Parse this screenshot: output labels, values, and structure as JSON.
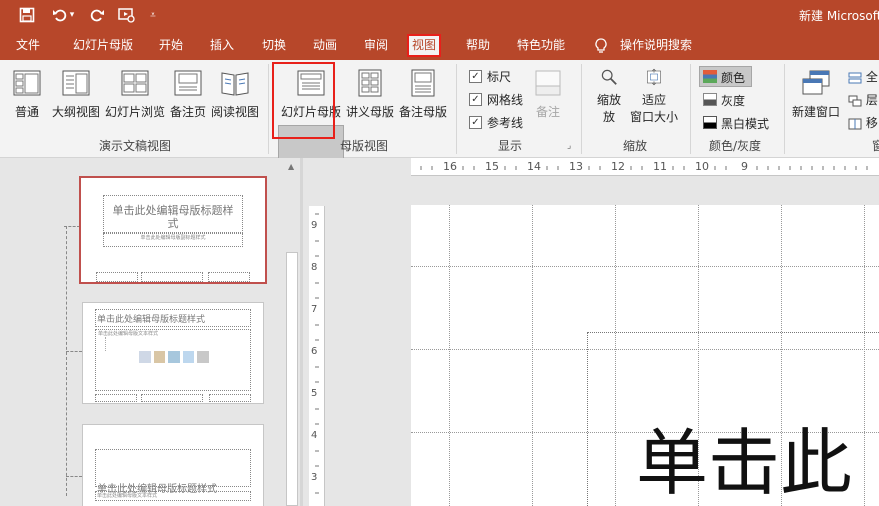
{
  "app": {
    "title": "新建 Microsoft"
  },
  "tabs": [
    "文件",
    "幻灯片母版",
    "开始",
    "插入",
    "切换",
    "动画",
    "审阅",
    "视图",
    "帮助",
    "特色功能"
  ],
  "active_tab": "视图",
  "tell_me": "操作说明搜索",
  "ribbon": {
    "presentation_views": {
      "label": "演示文稿视图",
      "buttons": [
        "普通",
        "大纲视图",
        "幻灯片浏览",
        "备注页",
        "阅读视图"
      ]
    },
    "master_views": {
      "label": "母版视图",
      "buttons": [
        "幻灯片母版",
        "讲义母版",
        "备注母版"
      ],
      "selected": "幻灯片母版"
    },
    "show": {
      "label": "显示",
      "ruler": "标尺",
      "gridlines": "网格线",
      "guides": "参考线",
      "notes": "备注"
    },
    "zoom": {
      "label": "缩放",
      "zoom": "缩放",
      "fit_line1": "适应",
      "fit_line2": "窗口大小"
    },
    "color": {
      "label": "颜色/灰度",
      "color": "颜色",
      "grayscale": "灰度",
      "bw": "黑白模式"
    },
    "window": {
      "new_window": "新建窗口",
      "arrange_all": "全",
      "cascade": "层",
      "move_split": "移",
      "group_cut": "窗"
    }
  },
  "slides": {
    "master_title": "单击此处编辑母版标题样式",
    "master_title_l1": "单击此处编辑母版标题样",
    "master_title_l2": "式",
    "master_subtitle": "单击此处编辑母版副标题样式",
    "master_text": "单击此处编辑母版文本样式"
  },
  "ruler": {
    "h": [
      "16",
      "15",
      "14",
      "13",
      "12",
      "11",
      "10",
      "9"
    ],
    "v": [
      "9",
      "8",
      "7",
      "6",
      "5",
      "4",
      "3"
    ]
  },
  "editor": {
    "big_title": "单击此"
  }
}
